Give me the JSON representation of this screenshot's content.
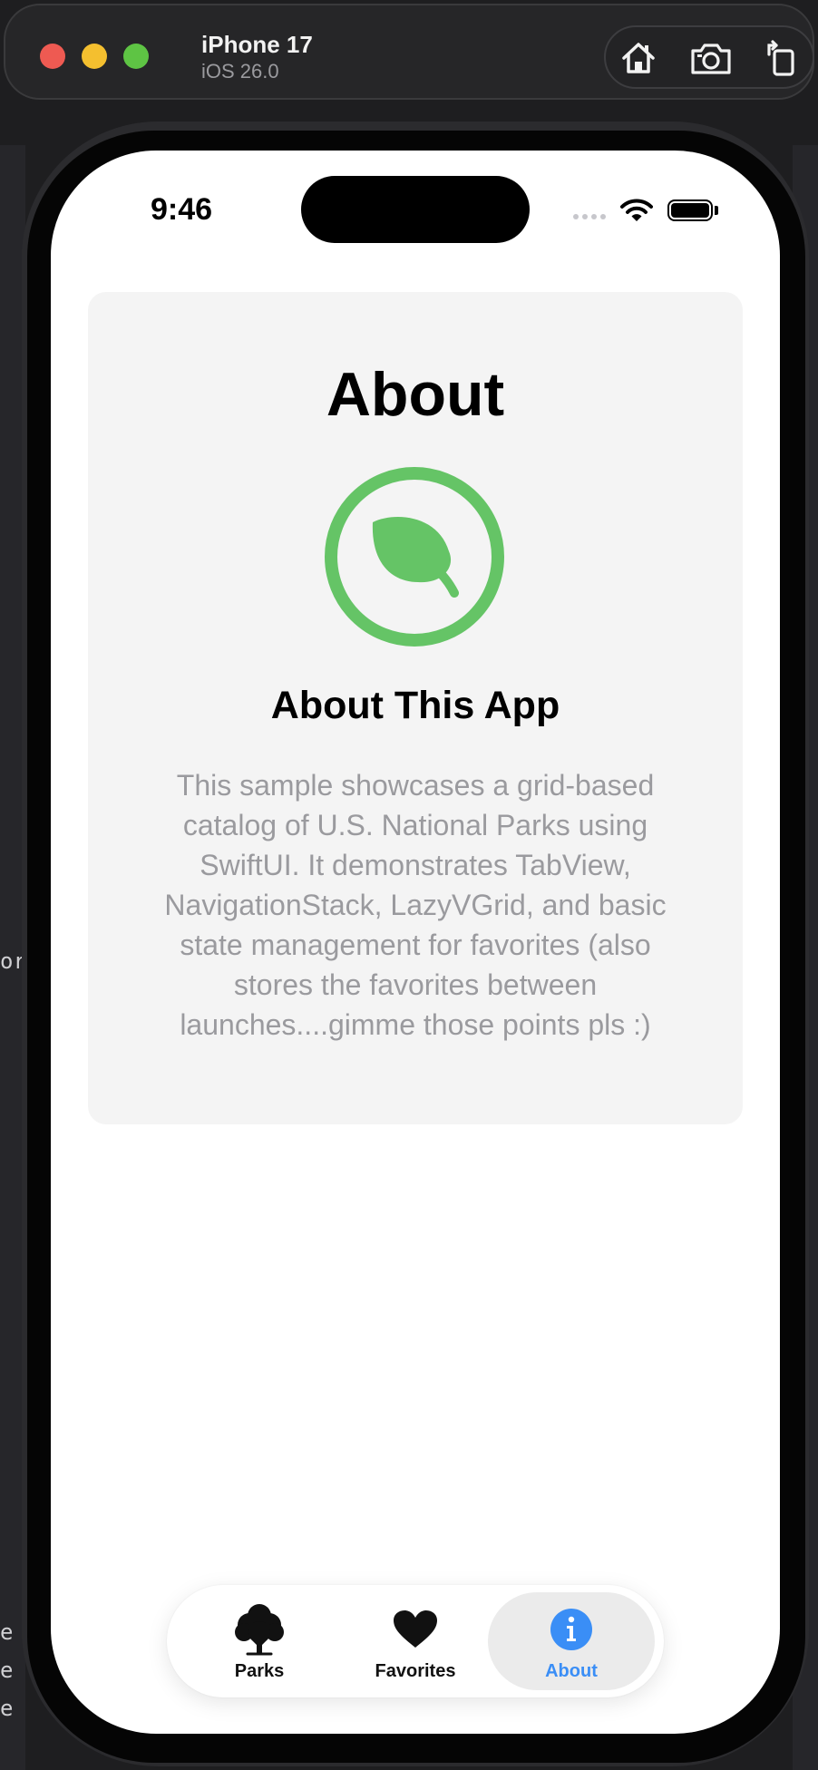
{
  "window": {
    "device_name": "iPhone 17",
    "os_version": "iOS 26.0",
    "toolbar_icons": [
      "home-icon",
      "screenshot-icon",
      "rotate-icon"
    ]
  },
  "status_bar": {
    "time": "9:46"
  },
  "background_text": {
    "lines": [
      "or",
      "e",
      "e",
      "e"
    ]
  },
  "about_card": {
    "title": "About",
    "emblem_icon": "leaf-icon",
    "subtitle": "About This App",
    "description": "This sample showcases a grid-based catalog of U.S. National Parks using SwiftUI. It demonstrates TabView, NavigationStack, LazyVGrid, and basic state management for favorites (also stores the favorites between launches....gimme those points pls :)"
  },
  "tab_bar": {
    "tabs": [
      {
        "label": "Parks",
        "icon": "tree-icon",
        "selected": false
      },
      {
        "label": "Favorites",
        "icon": "heart-icon",
        "selected": false
      },
      {
        "label": "About",
        "icon": "info-icon",
        "selected": true
      }
    ]
  },
  "colors": {
    "accent": "#3a8ef6",
    "emblem_green": "#65c466",
    "card_background": "#f4f4f4",
    "body_text": "#9a9a9e"
  }
}
